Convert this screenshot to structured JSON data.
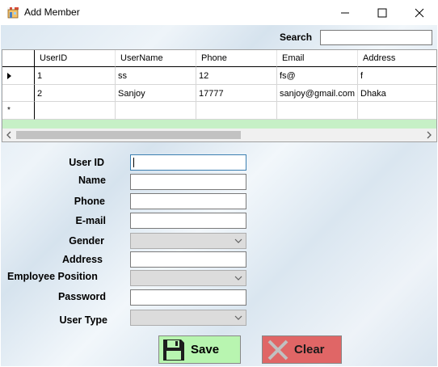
{
  "window": {
    "title": "Add Member"
  },
  "search": {
    "label": "Search",
    "value": ""
  },
  "grid": {
    "columns": [
      "UserID",
      "UserName",
      "Phone",
      "Email",
      "Address"
    ],
    "rows": [
      [
        "1",
        "ss",
        "12",
        "fs@",
        "f"
      ],
      [
        "2",
        "Sanjoy",
        "17777",
        "sanjoy@gmail.com",
        "Dhaka"
      ]
    ],
    "new_row_marker": "*"
  },
  "form": {
    "user_id_label": "User ID",
    "name_label": "Name",
    "phone_label": "Phone",
    "email_label": "E-mail",
    "gender_label": "Gender",
    "address_label": "Address",
    "position_label": "Employee Position",
    "password_label": "Password",
    "user_type_label": "User Type"
  },
  "buttons": {
    "save": "Save",
    "clear": "Clear"
  },
  "colors": {
    "save_bg": "#b8f5b0",
    "clear_bg": "#e06666",
    "grid_band": "#c6f0c6"
  }
}
